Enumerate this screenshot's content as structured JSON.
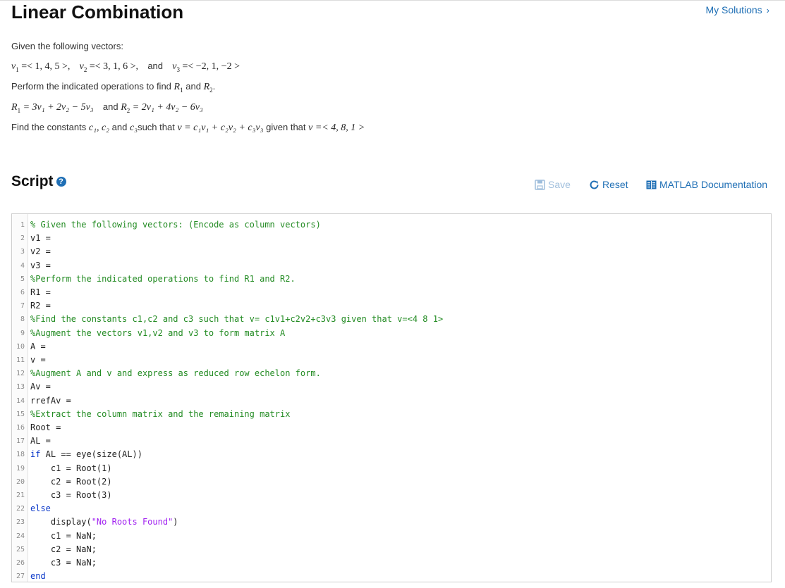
{
  "header": {
    "title": "Linear Combination",
    "my_solutions": "My Solutions",
    "chevron": "›"
  },
  "problem": {
    "intro": "Given the following vectors:",
    "vectors": {
      "v1_label": "v",
      "v1_sub": "1",
      "v1_value": "=< 1, 4, 5 >,",
      "v2_label": "v",
      "v2_sub": "2",
      "v2_value": "=< 3, 1, 6 >,",
      "and": "and",
      "v3_label": "v",
      "v3_sub": "3",
      "v3_value": "=< −2, 1, −2 >"
    },
    "perform_text": "Perform the indicated operations to find",
    "perform_r1": "R",
    "perform_r1_sub": "1",
    "perform_and": "and",
    "perform_r2": "R",
    "perform_r2_sub": "2",
    "perform_end": ".",
    "r1_expr_lhs": "R",
    "r1_expr_sub": "1",
    "r1_expr": "= 3v₁ + 2v₂ − 5v₃",
    "r2_and": "and",
    "r2_expr_lhs": "R",
    "r2_expr_sub": "2",
    "r2_expr": "= 2v₁ + 4v₂ − 6v₃",
    "find_text": "Find the constants",
    "find_consts": "c₁, c₂",
    "find_and": "and",
    "find_c3": "c₃",
    "find_such": "such that",
    "find_expr": "v = c₁v₁ + c₂v₂ + c₃v₃",
    "find_given": "given that",
    "find_v": "v =< 4, 8, 1 >"
  },
  "script": {
    "heading": "Script",
    "help_icon": "?",
    "save_label": "Save",
    "reset_label": "Reset",
    "doc_label": "MATLAB Documentation"
  },
  "colors": {
    "link": "#1f6fb5",
    "comment": "#228B22",
    "keyword": "#0b38c9",
    "string": "#a020f0"
  },
  "code_lines": [
    {
      "n": "1",
      "parts": [
        [
          "cmt",
          "% Given the following vectors: (Encode as column vectors)"
        ]
      ]
    },
    {
      "n": "2",
      "parts": [
        [
          "",
          "v1 ="
        ]
      ]
    },
    {
      "n": "3",
      "parts": [
        [
          "",
          "v2 ="
        ]
      ]
    },
    {
      "n": "4",
      "parts": [
        [
          "",
          "v3 ="
        ]
      ]
    },
    {
      "n": "5",
      "parts": [
        [
          "cmt",
          "%Perform the indicated operations to find R1 and R2."
        ]
      ]
    },
    {
      "n": "6",
      "parts": [
        [
          "",
          "R1 ="
        ]
      ]
    },
    {
      "n": "7",
      "parts": [
        [
          "",
          "R2 ="
        ]
      ]
    },
    {
      "n": "8",
      "parts": [
        [
          "cmt",
          "%Find the constants c1,c2 and c3 such that v= c1v1+c2v2+c3v3 given that v=<4 8 1>"
        ]
      ]
    },
    {
      "n": "9",
      "parts": [
        [
          "cmt",
          "%Augment the vectors v1,v2 and v3 to form matrix A"
        ]
      ]
    },
    {
      "n": "10",
      "parts": [
        [
          "",
          "A ="
        ]
      ]
    },
    {
      "n": "11",
      "parts": [
        [
          "",
          "v ="
        ]
      ]
    },
    {
      "n": "12",
      "parts": [
        [
          "cmt",
          "%Augment A and v and express as reduced row echelon form."
        ]
      ]
    },
    {
      "n": "13",
      "parts": [
        [
          "",
          "Av ="
        ]
      ]
    },
    {
      "n": "14",
      "parts": [
        [
          "",
          "rrefAv ="
        ]
      ]
    },
    {
      "n": "15",
      "parts": [
        [
          "cmt",
          "%Extract the column matrix and the remaining matrix"
        ]
      ]
    },
    {
      "n": "16",
      "parts": [
        [
          "",
          "Root ="
        ]
      ]
    },
    {
      "n": "17",
      "parts": [
        [
          "",
          "AL ="
        ]
      ]
    },
    {
      "n": "18",
      "parts": [
        [
          "kw",
          "if"
        ],
        [
          "",
          " AL == eye(size(AL))"
        ]
      ]
    },
    {
      "n": "19",
      "parts": [
        [
          "",
          "    c1 = Root(1)"
        ]
      ]
    },
    {
      "n": "20",
      "parts": [
        [
          "",
          "    c2 = Root(2)"
        ]
      ]
    },
    {
      "n": "21",
      "parts": [
        [
          "",
          "    c3 = Root(3)"
        ]
      ]
    },
    {
      "n": "22",
      "parts": [
        [
          "kw",
          "else"
        ]
      ]
    },
    {
      "n": "23",
      "parts": [
        [
          "",
          "    display("
        ],
        [
          "str",
          "\"No Roots Found\""
        ],
        [
          "",
          ")"
        ]
      ]
    },
    {
      "n": "24",
      "parts": [
        [
          "",
          "    c1 = NaN;"
        ]
      ]
    },
    {
      "n": "25",
      "parts": [
        [
          "",
          "    c2 = NaN;"
        ]
      ]
    },
    {
      "n": "26",
      "parts": [
        [
          "",
          "    c3 = NaN;"
        ]
      ]
    },
    {
      "n": "27",
      "parts": [
        [
          "kw",
          "end"
        ]
      ]
    }
  ]
}
